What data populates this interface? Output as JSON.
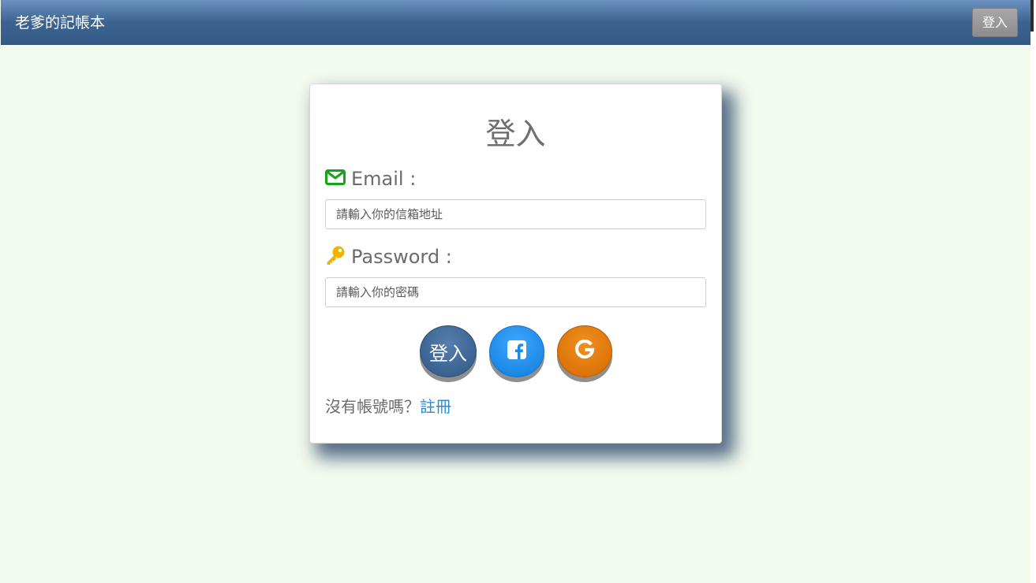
{
  "navbar": {
    "brand": "老爹的記帳本",
    "login_button": "登入"
  },
  "login_card": {
    "title": "登入",
    "email": {
      "icon": "envelope-icon",
      "label": "Email :",
      "placeholder": "請輸入你的信箱地址"
    },
    "password": {
      "icon": "key-icon",
      "label": "Password :",
      "placeholder": "請輸入你的密碼"
    },
    "buttons": {
      "login_label": "登入",
      "facebook_icon": "facebook-icon",
      "google_icon": "google-icon"
    },
    "signup": {
      "prompt": "沒有帳號嗎？",
      "link": "註冊"
    }
  },
  "colors": {
    "navbar": "#3d6490",
    "background": "#f3faee",
    "envelope_icon": "#1aa21a",
    "key_icon": "#f0b400",
    "facebook_button": "#1d8ae6",
    "google_button": "#dd750a",
    "link": "#2b8ccf"
  }
}
